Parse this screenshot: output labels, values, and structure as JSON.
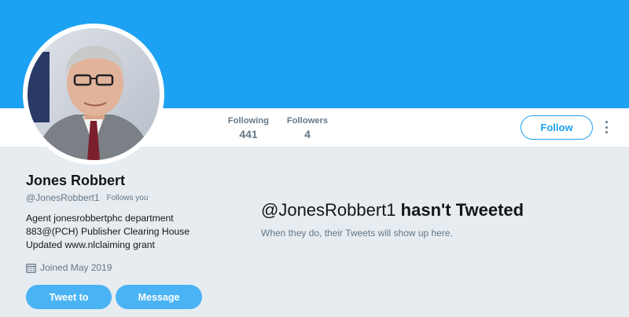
{
  "profile": {
    "name": "Jones Robbert",
    "handle": "@JonesRobbert1",
    "follows_you": "Follows you",
    "bio_lines": [
      "Agent jonesrobbertphc department",
      "883@(PCH) Publisher Clearing House",
      "Updated www.nlclaiming grant"
    ],
    "joined": "Joined May 2019"
  },
  "stats": {
    "following_label": "Following",
    "following_value": "441",
    "followers_label": "Followers",
    "followers_value": "4"
  },
  "actions": {
    "follow": "Follow",
    "tweet_to": "Tweet to",
    "message": "Message"
  },
  "empty_state": {
    "handle": "@JonesRobbert1",
    "title_suffix": "hasn't Tweeted",
    "subtitle": "When they do, their Tweets will show up here."
  },
  "colors": {
    "banner": "#1da1f2",
    "accent": "#1da1f2",
    "button_fill": "#4ab3f4",
    "page_bg": "#e6ecf0"
  },
  "icons": [
    "more-icon",
    "calendar-icon"
  ]
}
